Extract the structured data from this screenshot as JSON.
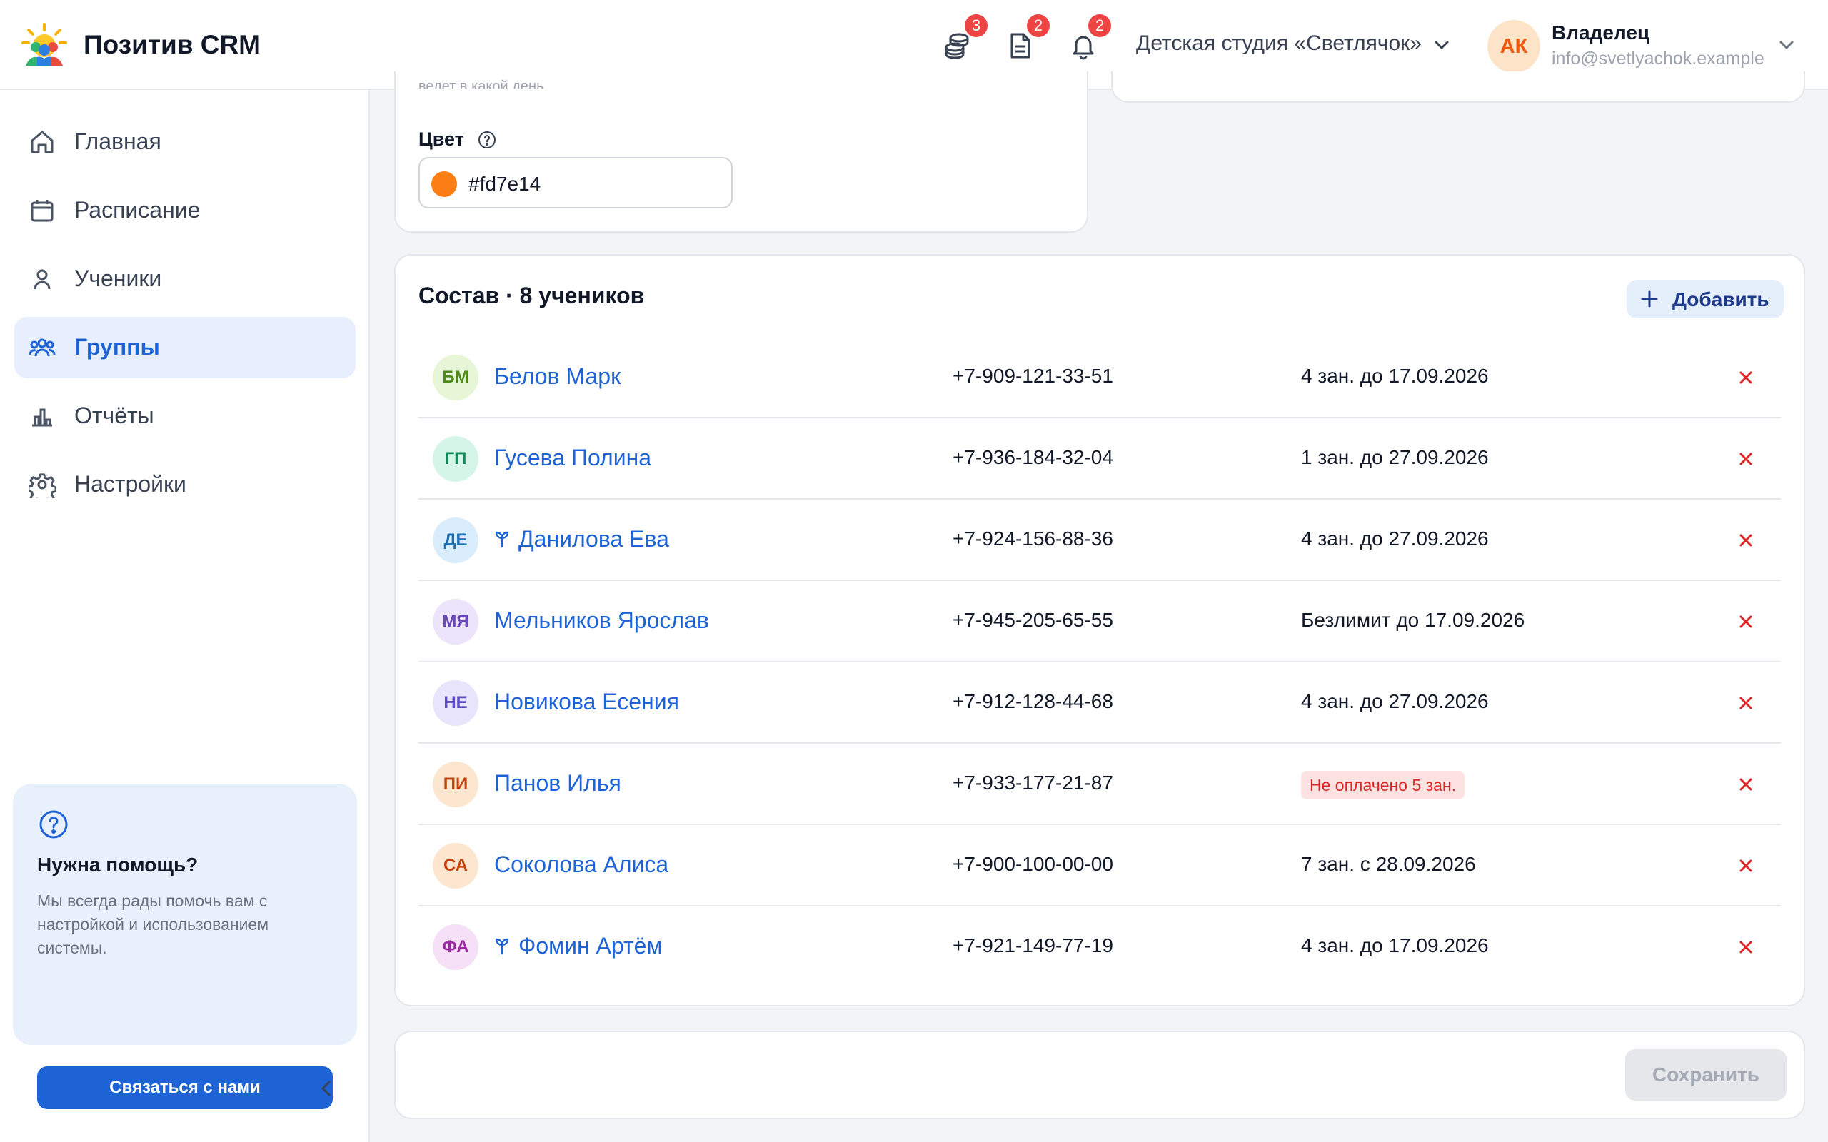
{
  "header": {
    "app_name": "Позитив CRM",
    "notifications": [
      {
        "icon": "coins-icon",
        "count": "3"
      },
      {
        "icon": "document-icon",
        "count": "2"
      },
      {
        "icon": "bell-icon",
        "count": "2"
      }
    ],
    "studio": "Детская студия «Светлячок»",
    "user": {
      "initials": "АК",
      "role": "Владелец",
      "email": "info@svetlyachok.example"
    }
  },
  "sidebar": {
    "items": [
      {
        "icon": "home-icon",
        "label": "Главная",
        "active": false
      },
      {
        "icon": "calendar-icon",
        "label": "Расписание",
        "active": false
      },
      {
        "icon": "user-icon",
        "label": "Ученики",
        "active": false
      },
      {
        "icon": "users-icon",
        "label": "Группы",
        "active": true
      },
      {
        "icon": "chart-icon",
        "label": "Отчёты",
        "active": false
      },
      {
        "icon": "gear-icon",
        "label": "Настройки",
        "active": false
      }
    ],
    "help": {
      "title": "Нужна помощь?",
      "text": "Мы всегда рады помочь вам с настройкой и использованием системы.",
      "button": "Связаться с нами"
    }
  },
  "form": {
    "cut_hint": "ведет в какой день",
    "color_label": "Цвет",
    "color_value": "#fd7e14"
  },
  "roster": {
    "title": "Состав · 8 учеников",
    "add_label": "Добавить",
    "students": [
      {
        "initials": "БМ",
        "name": "Белов Марк",
        "phone": "+7-909-121-33-51",
        "subscription": "4 зан. до 17.09.2026",
        "unpaid": false,
        "sprout": false,
        "bg": "#e6f6d6",
        "fg": "#4d8a1a"
      },
      {
        "initials": "ГП",
        "name": "Гусева Полина",
        "phone": "+7-936-184-32-04",
        "subscription": "1 зан. до 27.09.2026",
        "unpaid": false,
        "sprout": false,
        "bg": "#d5f5e8",
        "fg": "#138a5a"
      },
      {
        "initials": "ДЕ",
        "name": "Данилова Ева",
        "phone": "+7-924-156-88-36",
        "subscription": "4 зан. до 27.09.2026",
        "unpaid": false,
        "sprout": true,
        "bg": "#d8ecfb",
        "fg": "#1c6fb5"
      },
      {
        "initials": "МЯ",
        "name": "Мельников Ярослав",
        "phone": "+7-945-205-65-55",
        "subscription": "Безлимит до 17.09.2026",
        "unpaid": false,
        "sprout": false,
        "bg": "#ece4fb",
        "fg": "#6b46c1"
      },
      {
        "initials": "НЕ",
        "name": "Новикова Есения",
        "phone": "+7-912-128-44-68",
        "subscription": "4 зан. до 27.09.2026",
        "unpaid": false,
        "sprout": false,
        "bg": "#e8e4fc",
        "fg": "#5b4bc4"
      },
      {
        "initials": "ПИ",
        "name": "Панов Илья",
        "phone": "+7-933-177-21-87",
        "subscription": "Не оплачено 5 зан.",
        "unpaid": true,
        "sprout": false,
        "bg": "#fde6cf",
        "fg": "#c2410c"
      },
      {
        "initials": "СА",
        "name": "Соколова Алиса",
        "phone": "+7-900-100-00-00",
        "subscription": "7 зан. с 28.09.2026",
        "unpaid": false,
        "sprout": false,
        "bg": "#fde6cf",
        "fg": "#c2410c"
      },
      {
        "initials": "ФА",
        "name": "Фомин Артём",
        "phone": "+7-921-149-77-19",
        "subscription": "4 зан. до 17.09.2026",
        "unpaid": false,
        "sprout": true,
        "bg": "#f6e0f7",
        "fg": "#9c2aa3"
      }
    ]
  },
  "save_label": "Сохранить",
  "colors": {
    "accent": "#1d63d6",
    "danger": "#dc2626",
    "badge": "#ef4444",
    "swatch": "#fd7e14"
  }
}
